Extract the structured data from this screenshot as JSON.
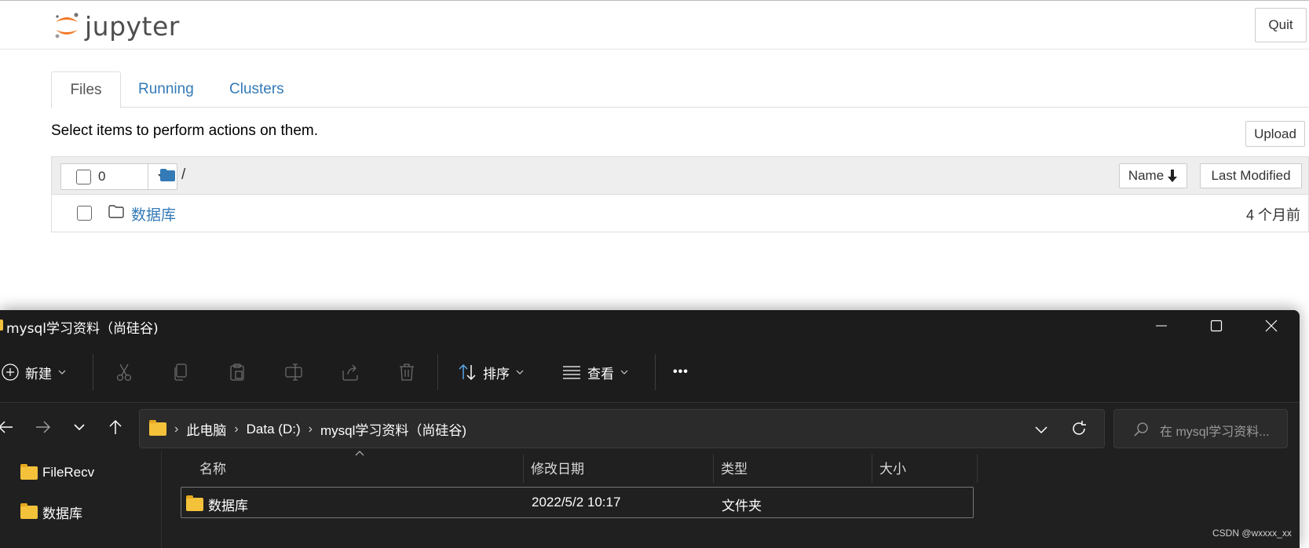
{
  "jupyter": {
    "logo_text": "jupyter",
    "quit_label": "Quit",
    "tabs": [
      {
        "label": "Files"
      },
      {
        "label": "Running"
      },
      {
        "label": "Clusters"
      }
    ],
    "hint": "Select items to perform actions on them.",
    "upload_label": "Upload",
    "list_header": {
      "selected_count": "0",
      "breadcrumb": "/",
      "sort_name_label": "Name",
      "sort_modified_label": "Last Modified"
    },
    "rows": [
      {
        "name": "数据库",
        "modified": "4 个月前"
      }
    ],
    "colors": {
      "link": "#337ab7",
      "logo_orange": "#f37726"
    }
  },
  "explorer": {
    "title": "mysql学习资料（尚硅谷)",
    "toolbar": {
      "new_label": "新建",
      "sort_label": "排序",
      "view_label": "查看",
      "more_label": "•••"
    },
    "address": {
      "crumbs": [
        "此电脑",
        "Data (D:)",
        "mysql学习资料（尚硅谷)"
      ],
      "search_placeholder": "在 mysql学习资料..."
    },
    "nav_items": [
      {
        "label": "FileRecv"
      },
      {
        "label": "数据库"
      }
    ],
    "columns": {
      "name": "名称",
      "modified": "修改日期",
      "type": "类型",
      "size": "大小"
    },
    "files": [
      {
        "name": "数据库",
        "modified": "2022/5/2 10:17",
        "type": "文件夹",
        "size": ""
      }
    ]
  },
  "watermark": "CSDN @wxxxx_xx"
}
